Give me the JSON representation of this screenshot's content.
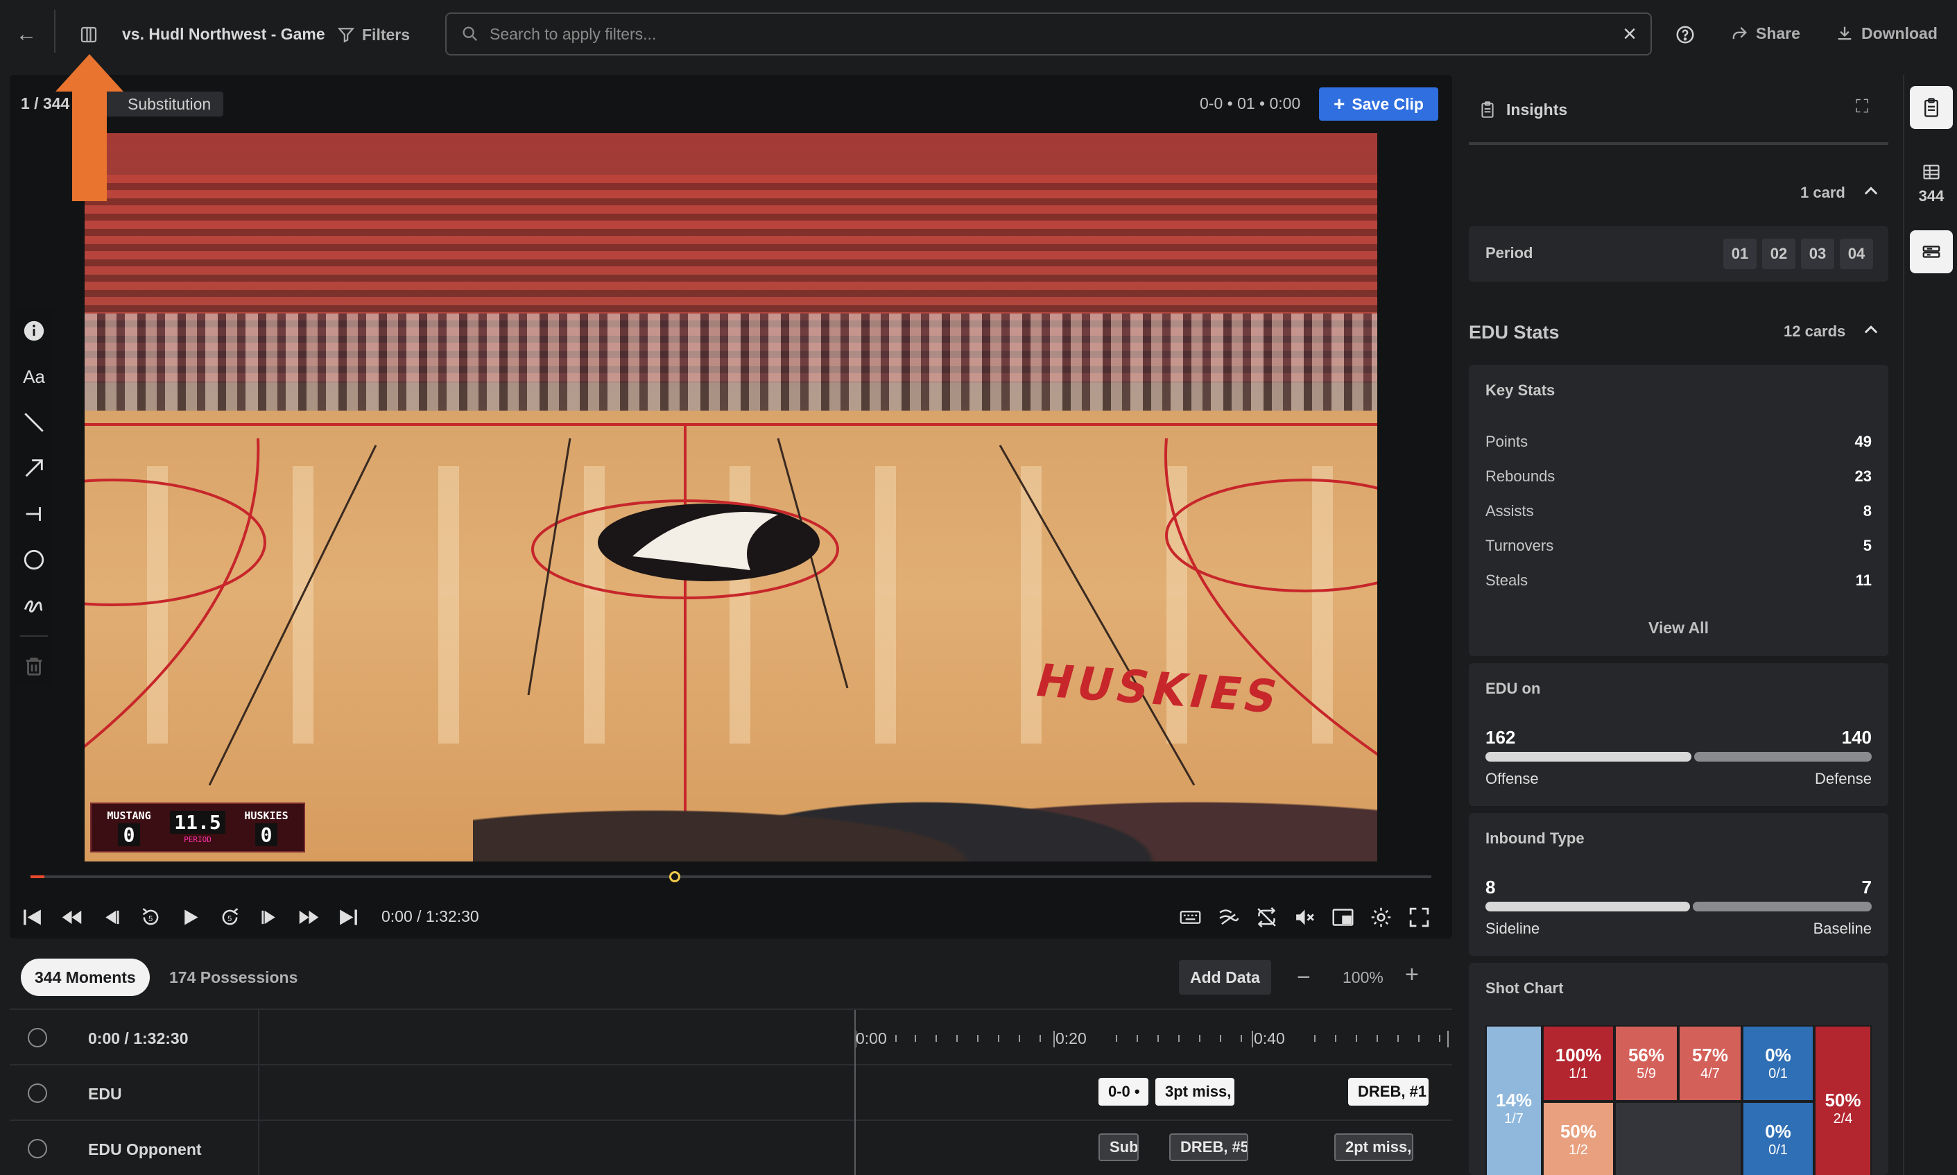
{
  "header": {
    "game_title": "vs. Hudl Northwest - Game",
    "filters_label": "Filters",
    "search_placeholder": "Search to apply filters...",
    "share_label": "Share",
    "download_label": "Download"
  },
  "clip": {
    "counter": "1 / 344",
    "tag": "Substitution",
    "meta": "0-0 • 01 • 0:00",
    "save_label": "Save Clip"
  },
  "scoreboard": {
    "team_left": "MUSTANG",
    "score_left": "0",
    "clock": "11.5",
    "period_label": "PERIOD",
    "team_right": "HUSKIES",
    "score_right": "0"
  },
  "court_wordmark": "HUSKIES",
  "player": {
    "time": "0:00 / 1:32:30",
    "progress_fraction": 0.46
  },
  "bottom": {
    "tab_moments": "344 Moments",
    "tab_possessions": "174 Possessions",
    "add_data_label": "Add Data",
    "zoom_out": "−",
    "zoom_level": "100%",
    "zoom_in": "+"
  },
  "timeline": {
    "header_label": "0:00 / 1:32:30",
    "ticks": [
      "0:00",
      "0:20",
      "0:40"
    ],
    "rows": [
      {
        "label": "EDU",
        "chips": [
          "0-0 •",
          "3pt miss,",
          "DREB, #1"
        ]
      },
      {
        "label": "EDU Opponent",
        "chips": [
          "Sub",
          "DREB, #5",
          "2pt miss,"
        ]
      }
    ]
  },
  "insights": {
    "title": "Insights",
    "top_count": "1 card",
    "period_label": "Period",
    "periods": [
      "01",
      "02",
      "03",
      "04"
    ],
    "section_title": "EDU Stats",
    "section_count": "12 cards",
    "key_stats": {
      "title": "Key Stats",
      "rows": [
        {
          "name": "Points",
          "value": "49"
        },
        {
          "name": "Rebounds",
          "value": "23"
        },
        {
          "name": "Assists",
          "value": "8"
        },
        {
          "name": "Turnovers",
          "value": "5"
        },
        {
          "name": "Steals",
          "value": "11"
        }
      ],
      "view_all": "View All"
    },
    "edu_on": {
      "title": "EDU on",
      "left_value": 162,
      "right_value": 140,
      "left_label": "Offense",
      "right_label": "Defense"
    },
    "inbound_type": {
      "title": "Inbound Type",
      "left_value": 8,
      "right_value": 7,
      "left_label": "Sideline",
      "right_label": "Baseline"
    },
    "shot_chart": {
      "title": "Shot Chart",
      "zones": [
        {
          "pct": "14%",
          "frac": "1/7",
          "color": "#8fb8dc"
        },
        {
          "pct": "100%",
          "frac": "1/1",
          "color": "#b3262f"
        },
        {
          "pct": "56%",
          "frac": "5/9",
          "color": "#d4605a"
        },
        {
          "pct": "57%",
          "frac": "4/7",
          "color": "#d4605a"
        },
        {
          "pct": "0%",
          "frac": "0/1",
          "color": "#2f6fb5"
        },
        {
          "pct": "50%",
          "frac": "2/4",
          "color": "#b3262f"
        },
        {
          "pct": "50%",
          "frac": "1/2",
          "color": "#e8a07f"
        },
        {
          "pct": "0%",
          "frac": "0/1",
          "color": "#2f6fb5"
        }
      ]
    }
  },
  "rail": {
    "count": "344"
  },
  "colors": {
    "accent": "#2f6fe0",
    "orange_pointer": "#e8742f",
    "progress_start": "#e8492d",
    "handle": "#f2c94c"
  }
}
